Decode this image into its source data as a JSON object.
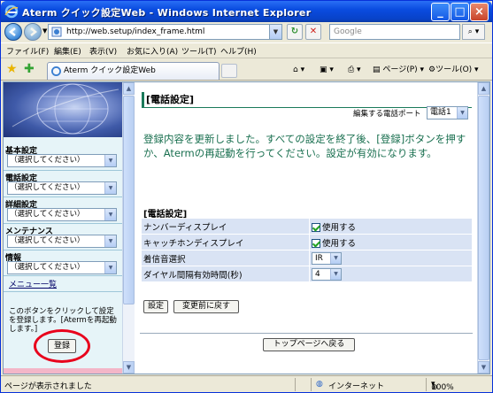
{
  "window": {
    "title": "Aterm クイック設定Web - Windows Internet Explorer"
  },
  "address_bar": {
    "url": "http://web.setup/index_frame.html",
    "search_placeholder": "Google"
  },
  "menu": [
    "ファイル(F)",
    "編集(E)",
    "表示(V)",
    "お気に入り(A)",
    "ツール(T)",
    "ヘルプ(H)"
  ],
  "tab": {
    "label": "Aterm クイック設定Web"
  },
  "toolbar": {
    "page_label": "ページ(P)",
    "tools_label": "ツール(O)"
  },
  "sidebar": {
    "sections": [
      {
        "label": "基本設定",
        "select": "（選択してください）"
      },
      {
        "label": "電話設定",
        "select": "（選択してください）"
      },
      {
        "label": "詳細設定",
        "select": "（選択してください）"
      },
      {
        "label": "メンテナンス",
        "select": "（選択してください）"
      },
      {
        "label": "情報",
        "select": "（選択してください）"
      }
    ],
    "menu_list_link": "メニュー一覧",
    "note": "このボタンをクリックして設定を登録します。[Atermを再起動します。]",
    "register_button": "登録"
  },
  "main": {
    "heading": "[電話設定]",
    "port_label": "編集する電話ポート",
    "port_value": "電話1",
    "message": "登録内容を更新しました。すべての設定を終了後、[登録]ボタンを押すか、Atermの再起動を行ってください。設定が有効になります。",
    "section_title": "[電話設定]",
    "rows": [
      {
        "label": "ナンバーディスプレイ",
        "value": "使用する"
      },
      {
        "label": "キャッチホンディスプレイ",
        "value": "使用する"
      },
      {
        "label": "着信音選択",
        "value": "IR"
      },
      {
        "label": "ダイヤル間隔有効時間(秒)",
        "value": "4"
      }
    ],
    "set_button": "設定",
    "revert_button": "変更前に戻す",
    "top_button": "トップページへ戻る"
  },
  "status": {
    "text": "ページが表示されました",
    "zone": "インターネット",
    "zoom": "100%"
  },
  "colors": {
    "accent_green": "#1a7050",
    "row_blue": "#d9e3f4",
    "sidebar_bg": "#e6f4f8",
    "highlight_red": "#e8001c"
  }
}
